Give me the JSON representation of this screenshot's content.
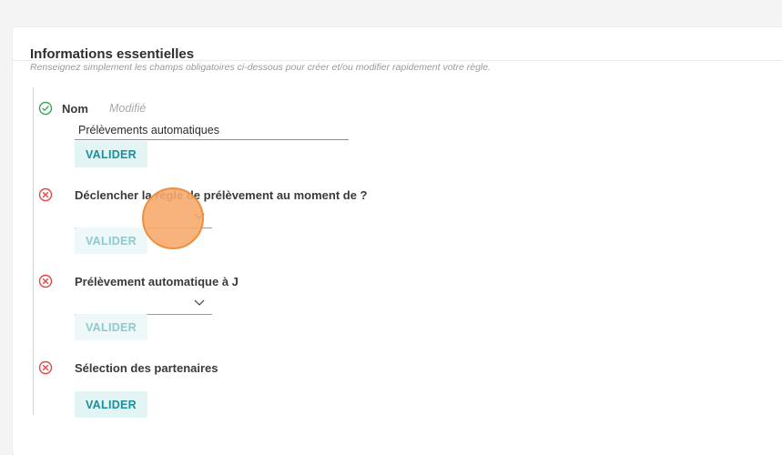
{
  "section": {
    "title": "Informations essentielles",
    "subtitle": "Renseignez simplement les champs obligatoires ci-dessous pour créer et/ou modifier rapidement votre règle."
  },
  "steps": [
    {
      "label": "Nom",
      "status_text": "Modifié",
      "state": "valid",
      "input_value": "Prélèvements automatiques",
      "button_label": "VALIDER",
      "button_enabled": true
    },
    {
      "label": "Déclencher la règle de prélèvement au moment de ?",
      "state": "invalid",
      "select_value": "",
      "button_label": "VALIDER",
      "button_enabled": false
    },
    {
      "label": "Prélèvement automatique à J",
      "state": "invalid",
      "select_value": "",
      "button_label": "VALIDER",
      "button_enabled": false
    },
    {
      "label": "Sélection des partenaires",
      "state": "invalid",
      "button_label": "VALIDER",
      "button_enabled": true
    }
  ],
  "colors": {
    "valid": "#3aa655",
    "invalid": "#e04848",
    "accent": "#1a8f9a",
    "button_bg": "#e3f4f5",
    "click_marker": "#f7aa6e"
  }
}
